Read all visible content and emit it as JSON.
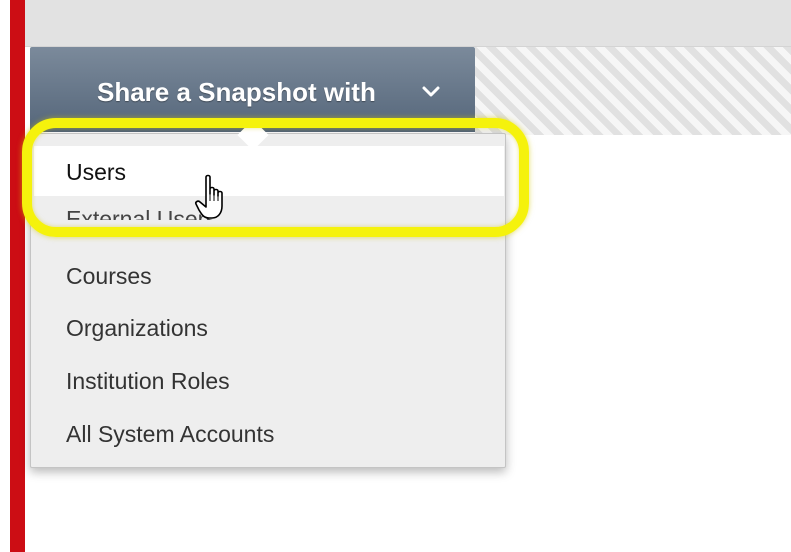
{
  "share_menu": {
    "button_label": "Share a Snapshot with",
    "chevron_icon": "chevron-down-icon",
    "items": [
      {
        "label": "Users"
      },
      {
        "label": "External Users"
      },
      {
        "label": "Courses"
      },
      {
        "label": "Organizations"
      },
      {
        "label": "Institution Roles"
      },
      {
        "label": "All System Accounts"
      }
    ]
  },
  "cursor_icon": "hand-pointer-icon",
  "colors": {
    "accent_red": "#cc0d14",
    "tab_gradient_top": "#7b8a9b",
    "tab_gradient_bottom": "#55667a",
    "highlight_yellow": "#f5f20c",
    "menu_background": "#eeeeee"
  }
}
